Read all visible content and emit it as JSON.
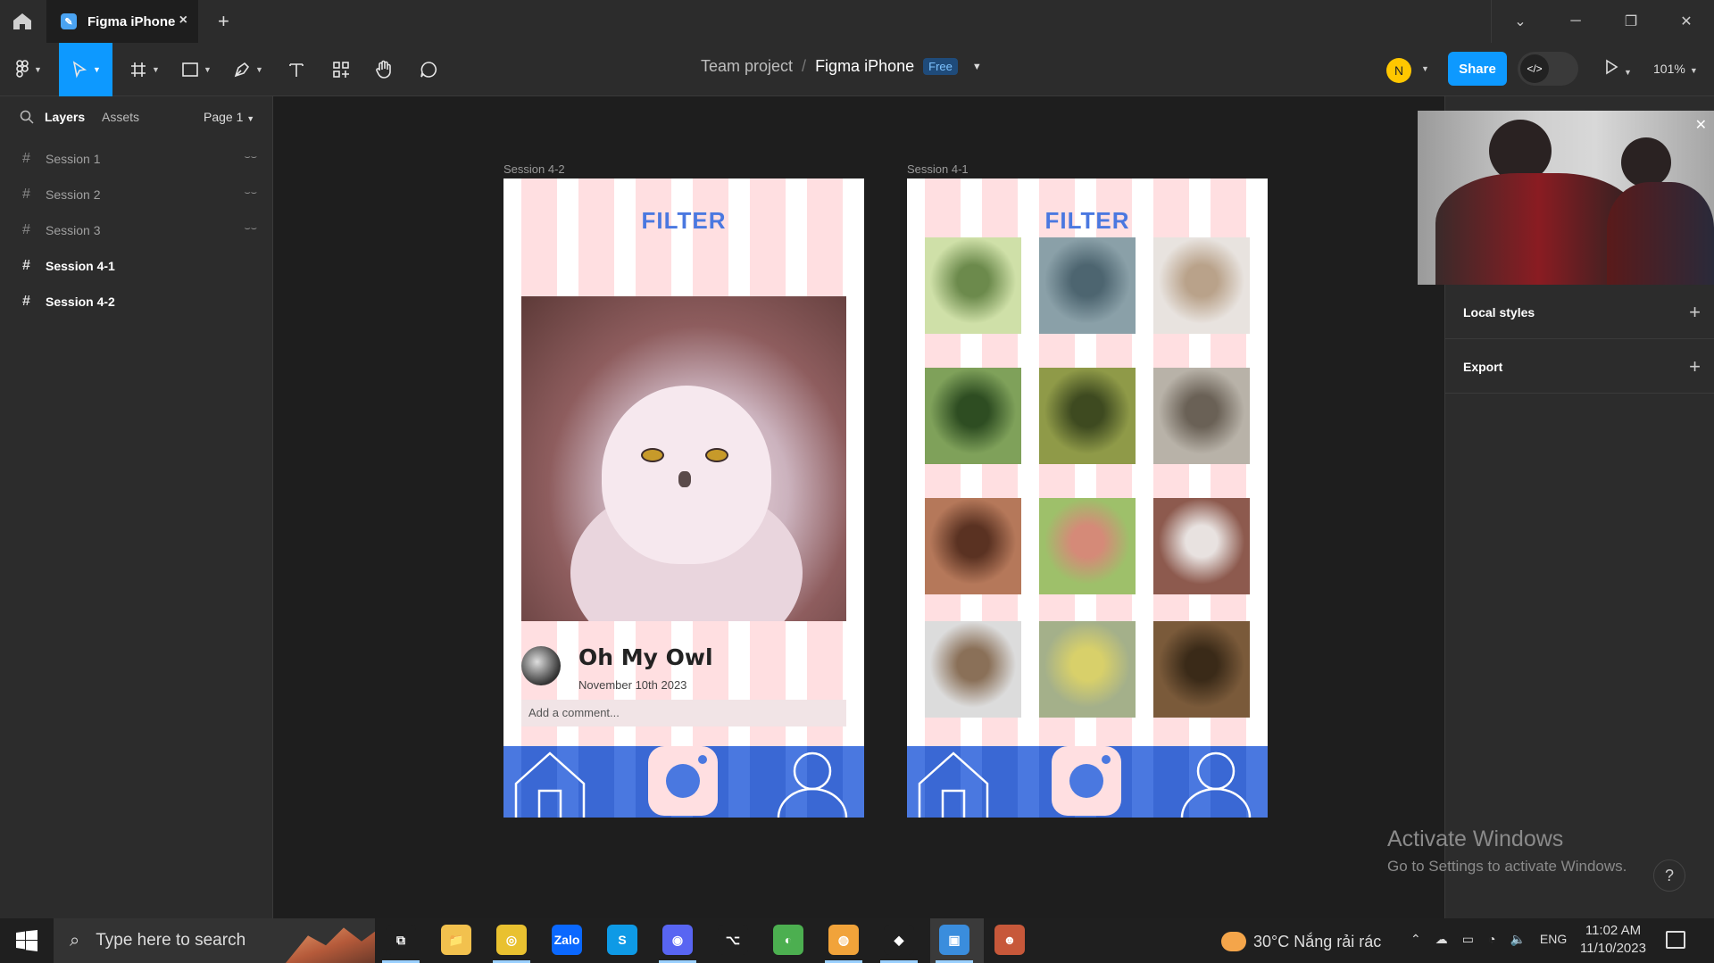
{
  "window": {
    "tab_title": "Figma iPhone",
    "tab_close": "×",
    "new_tab": "+",
    "controls": [
      "⌄",
      "─",
      "❐",
      "✕"
    ]
  },
  "toolbar": {
    "breadcrumb_team": "Team project",
    "breadcrumb_sep": "/",
    "breadcrumb_file": "Figma iPhone",
    "plan_badge": "Free",
    "user_initial": "N",
    "share_label": "Share",
    "dev_mode_icon": "</>",
    "zoom_level": "101%"
  },
  "left_panel": {
    "tabs": [
      "Layers",
      "Assets"
    ],
    "page_label": "Page 1",
    "layers": [
      {
        "name": "Session 1",
        "hidden": true
      },
      {
        "name": "Session 2",
        "hidden": true
      },
      {
        "name": "Session 3",
        "hidden": true
      },
      {
        "name": "Session 4-1",
        "hidden": false
      },
      {
        "name": "Session 4-2",
        "hidden": false
      }
    ]
  },
  "canvas": {
    "frame_a_label": "Session 4-2",
    "frame_b_label": "Session 4-1",
    "filter_title": "FILTER",
    "post_title": "Oh My Owl",
    "post_date": "November 10th 2023",
    "comment_placeholder": "Add a comment...",
    "grid_photos": [
      [
        "#cfe0a8",
        "#6c8a4c"
      ],
      [
        "#8aa0a8",
        "#4d6570"
      ],
      [
        "#e8e3df",
        "#b9a28a"
      ],
      [
        "#7fa15a",
        "#2e4d22"
      ],
      [
        "#8f9a48",
        "#3e4a20"
      ],
      [
        "#b8b2a8",
        "#6a6156"
      ],
      [
        "#b5785a",
        "#5a3222"
      ],
      [
        "#9ec06a",
        "#d58a78"
      ],
      [
        "#8d5a4e",
        "#e8e2e0"
      ],
      [
        "#dcdcdc",
        "#8a7058"
      ],
      [
        "#a4b08a",
        "#d8d06a"
      ],
      [
        "#7a5a3a",
        "#3a2a18"
      ]
    ]
  },
  "right_panel": {
    "local_styles": "Local styles",
    "export": "Export",
    "plus": "+"
  },
  "overlay": {
    "video_close": "✕",
    "activate_title": "Activate Windows",
    "activate_sub": "Go to Settings to activate Windows.",
    "help": "?"
  },
  "taskbar": {
    "search_placeholder": "Type here to search",
    "weather": "30°C  Nắng rải rác",
    "lang": "ENG",
    "time": "11:02 AM",
    "date": "11/10/2023",
    "apps": [
      {
        "name": "task-view",
        "label": "⧉",
        "color": "#1f1f1f"
      },
      {
        "name": "file-explorer",
        "label": "📁",
        "color": "#f2c14e"
      },
      {
        "name": "app-yellow",
        "label": "◎",
        "color": "#e9c130"
      },
      {
        "name": "zalo",
        "label": "Zalo",
        "color": "#0a68ff"
      },
      {
        "name": "skype",
        "label": "S",
        "color": "#0e9ae6"
      },
      {
        "name": "discord",
        "label": "◉",
        "color": "#5865f2"
      },
      {
        "name": "vscode",
        "label": "⌥",
        "color": "#1f1f1f"
      },
      {
        "name": "green-app",
        "label": "◐",
        "color": "#4caf50"
      },
      {
        "name": "browser",
        "label": "◍",
        "color": "#f1a33a"
      },
      {
        "name": "figma",
        "label": "◆",
        "color": "#1f1f1f"
      },
      {
        "name": "active-app",
        "label": "▣",
        "color": "#3a8ddd"
      },
      {
        "name": "game-app",
        "label": "☻",
        "color": "#c7583a"
      }
    ]
  }
}
